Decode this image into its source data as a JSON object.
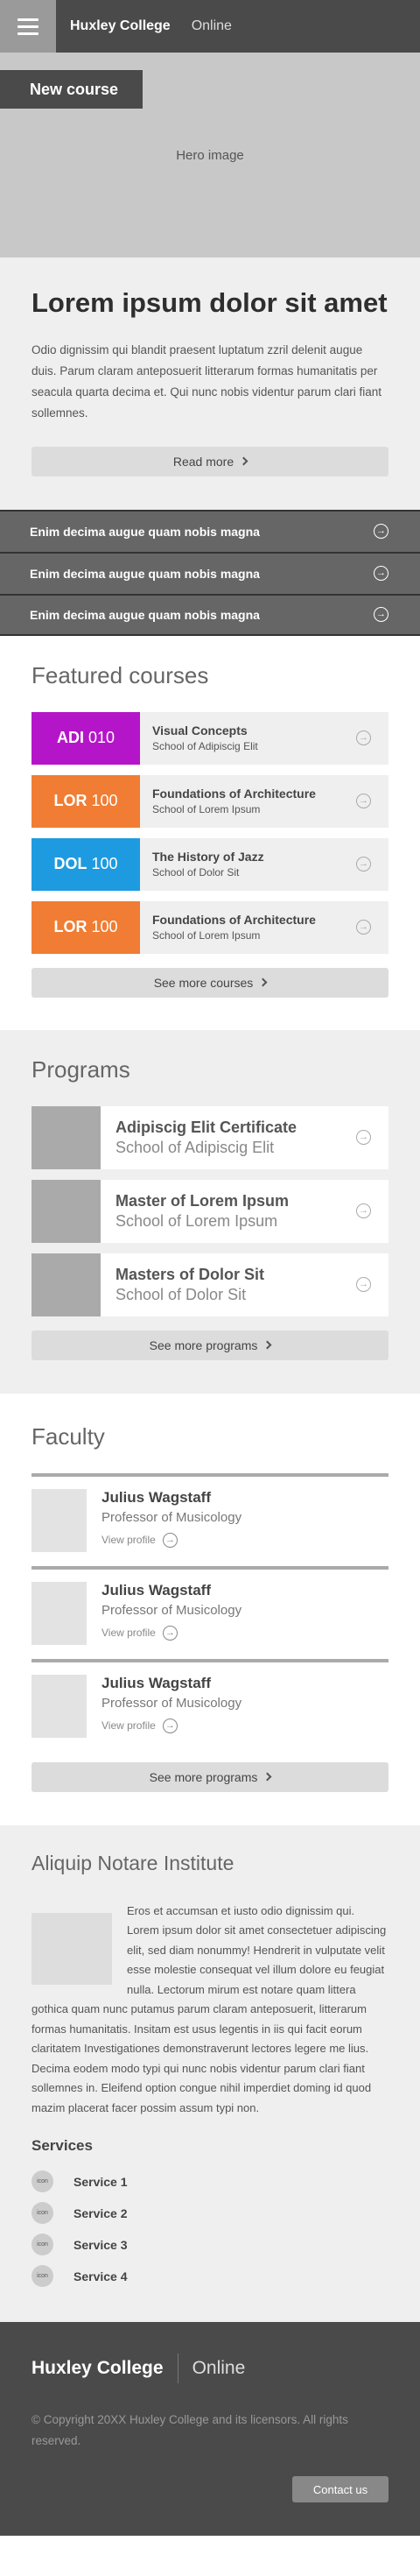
{
  "header": {
    "brand": "Huxley College",
    "subtitle": "Online",
    "menu_icon": "hamburger-menu-icon"
  },
  "hero": {
    "image_label": "Hero image",
    "badge": "New course"
  },
  "intro": {
    "heading": "Lorem ipsum dolor sit amet",
    "body": "Odio dignissim qui blandit praesent luptatum zzril delenit augue duis. Parum claram anteposuerit litterarum formas humanitatis per seacula quarta decima et. Qui nunc nobis videntur parum clari fiant sollemnes.",
    "read_more": "Read more"
  },
  "accordion": [
    {
      "label": "Enim decima augue quam nobis magna"
    },
    {
      "label": "Enim decima augue quam nobis magna"
    },
    {
      "label": "Enim decima augue quam nobis magna"
    }
  ],
  "featured": {
    "title": "Featured courses",
    "courses": [
      {
        "prefix": "ADI",
        "number": "010",
        "color": "#b515c9",
        "title": "Visual Concepts",
        "school": "School of Adipiscig Elit"
      },
      {
        "prefix": "LOR",
        "number": "100",
        "color": "#f07d33",
        "title": "Foundations of Architecture",
        "school": "School of Lorem Ipsum"
      },
      {
        "prefix": "DOL",
        "number": "100",
        "color": "#1e9be0",
        "title": "The History of Jazz",
        "school": "School of Dolor Sit"
      },
      {
        "prefix": "LOR",
        "number": "100",
        "color": "#f07d33",
        "title": "Foundations of Architecture",
        "school": "School of Lorem Ipsum"
      }
    ],
    "see_more": "See more courses"
  },
  "programs": {
    "title": "Programs",
    "items": [
      {
        "title": "Adipiscig Elit Certificate",
        "school": "School of Adipiscig Elit"
      },
      {
        "title": "Master of Lorem Ipsum",
        "school": "School of Lorem Ipsum"
      },
      {
        "title": "Masters of Dolor Sit",
        "school": "School of Dolor Sit"
      }
    ],
    "see_more": "See more programs"
  },
  "faculty": {
    "title": "Faculty",
    "members": [
      {
        "name": "Julius Wagstaff",
        "role": "Professor of Musicology",
        "link": "View profile"
      },
      {
        "name": "Julius Wagstaff",
        "role": "Professor of Musicology",
        "link": "View profile"
      },
      {
        "name": "Julius Wagstaff",
        "role": "Professor of Musicology",
        "link": "View profile"
      }
    ],
    "see_more": "See more programs"
  },
  "institute": {
    "title": "Aliquip Notare Institute",
    "body": "Eros et accumsan et iusto odio dignissim qui. Lorem ipsum dolor sit amet consectetuer adipiscing elit, sed diam nonummy! Hendrerit in vulputate velit esse molestie consequat vel illum dolore eu feugiat nulla. Lectorum mirum est notare quam littera gothica quam nunc putamus parum claram anteposuerit, litterarum formas humanitatis. Insitam est usus legentis in iis qui facit eorum claritatem Investigationes demonstraverunt lectores legere me lius. Decima eodem modo typi qui nunc nobis videntur parum clari fiant sollemnes in. Eleifend option congue nihil imperdiet doming id quod mazim placerat facer possim assum typi non.",
    "services_title": "Services",
    "services": [
      {
        "icon": "icon",
        "label": "Service 1"
      },
      {
        "icon": "icon",
        "label": "Service 2"
      },
      {
        "icon": "icon",
        "label": "Service 3"
      },
      {
        "icon": "icon",
        "label": "Service 4"
      }
    ]
  },
  "footer": {
    "brand": "Huxley College",
    "subtitle": "Online",
    "copyright": "© Copyright 20XX Huxley College and its licensors. All rights reserved.",
    "contact": "Contact us"
  }
}
